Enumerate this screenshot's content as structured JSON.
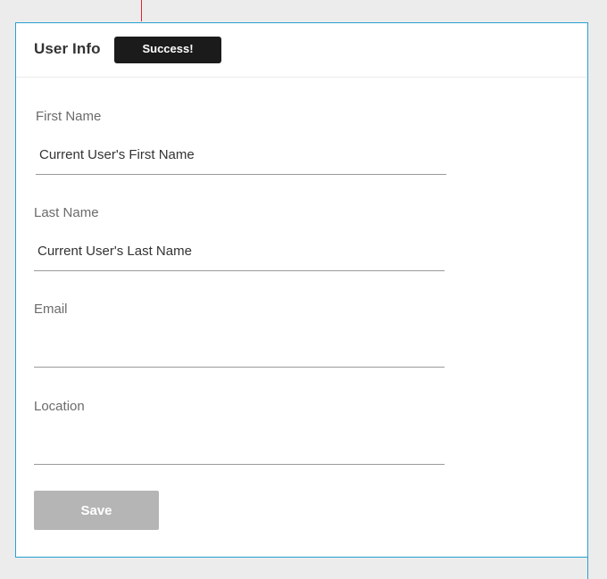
{
  "header": {
    "title": "User Info",
    "toast": "Success!"
  },
  "form": {
    "first_name": {
      "label": "First Name",
      "value": "Current User's First Name"
    },
    "last_name": {
      "label": "Last Name",
      "value": "Current User's Last Name"
    },
    "email": {
      "label": "Email",
      "value": ""
    },
    "location": {
      "label": "Location",
      "value": ""
    },
    "save_label": "Save"
  },
  "colors": {
    "accent_border": "#2a9fd0",
    "guide_line": "#e0243a",
    "toast_background": "#1b1b1b",
    "save_button_disabled": "#b5b5b5"
  }
}
